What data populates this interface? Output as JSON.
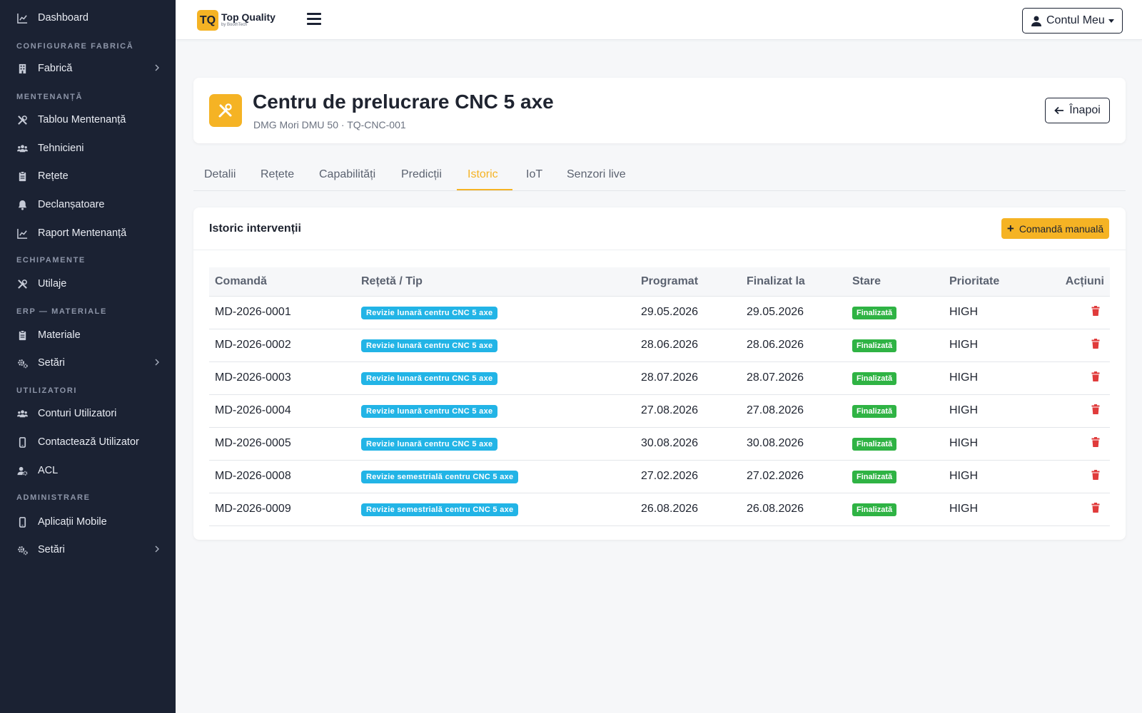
{
  "sidebar": {
    "items": [
      {
        "label": "Dashboard",
        "icon": "chart-line-icon"
      },
      {
        "label": "Fabrică",
        "icon": "building-icon",
        "has_submenu": true
      },
      {
        "label": "Tablou Mentenanță",
        "icon": "tools-icon"
      },
      {
        "label": "Tehnicieni",
        "icon": "users-icon"
      },
      {
        "label": "Rețete",
        "icon": "clipboard-icon"
      },
      {
        "label": "Declanșatoare",
        "icon": "bell-icon"
      },
      {
        "label": "Raport Mentenanță",
        "icon": "chart-line-icon"
      },
      {
        "label": "Utilaje",
        "icon": "tools-icon"
      },
      {
        "label": "Materiale",
        "icon": "clipboard-icon"
      },
      {
        "label": "Setări",
        "icon": "gears-icon",
        "has_submenu": true
      },
      {
        "label": "Conturi Utilizatori",
        "icon": "users-icon"
      },
      {
        "label": "Contactează Utilizator",
        "icon": "mobile-icon"
      },
      {
        "label": "ACL",
        "icon": "user-gear-icon"
      },
      {
        "label": "Aplicații Mobile",
        "icon": "mobile-icon"
      },
      {
        "label": "Setări",
        "icon": "gears-icon",
        "has_submenu": true
      }
    ],
    "sections": [
      "CONFIGURARE FABRICĂ",
      "MENTENANȚĂ",
      "ECHIPAMENTE",
      "ERP — MATERIALE",
      "UTILIZATORI",
      "ADMINISTRARE"
    ]
  },
  "topbar": {
    "logo_mark": "TQ",
    "logo_name": "Top Quality",
    "logo_sub": "by BoothTech",
    "account_label": "Contul Meu"
  },
  "header": {
    "title": "Centru de prelucrare CNC 5 axe",
    "subtitle": "DMG Mori DMU 50 · TQ-CNC-001",
    "back_label": "Înapoi"
  },
  "tabs": [
    {
      "label": "Detalii",
      "active": false
    },
    {
      "label": "Rețete",
      "active": false
    },
    {
      "label": "Capabilități",
      "active": false
    },
    {
      "label": "Predicții",
      "active": false
    },
    {
      "label": "Istoric",
      "active": true
    },
    {
      "label": "IoT",
      "active": false
    },
    {
      "label": "Senzori live",
      "active": false
    }
  ],
  "history": {
    "title": "Istoric intervenții",
    "manual_button": "Comandă manuală",
    "columns": [
      "Comandă",
      "Rețetă / Tip",
      "Programat",
      "Finalizat la",
      "Stare",
      "Prioritate",
      "Acțiuni"
    ],
    "rows": [
      {
        "order": "MD-2026-0001",
        "recipe": "Revizie lunară centru CNC 5 axe",
        "scheduled": "29.05.2026",
        "finished": "29.05.2026",
        "status": "Finalizată",
        "priority": "HIGH"
      },
      {
        "order": "MD-2026-0002",
        "recipe": "Revizie lunară centru CNC 5 axe",
        "scheduled": "28.06.2026",
        "finished": "28.06.2026",
        "status": "Finalizată",
        "priority": "HIGH"
      },
      {
        "order": "MD-2026-0003",
        "recipe": "Revizie lunară centru CNC 5 axe",
        "scheduled": "28.07.2026",
        "finished": "28.07.2026",
        "status": "Finalizată",
        "priority": "HIGH"
      },
      {
        "order": "MD-2026-0004",
        "recipe": "Revizie lunară centru CNC 5 axe",
        "scheduled": "27.08.2026",
        "finished": "27.08.2026",
        "status": "Finalizată",
        "priority": "HIGH"
      },
      {
        "order": "MD-2026-0005",
        "recipe": "Revizie lunară centru CNC 5 axe",
        "scheduled": "30.08.2026",
        "finished": "30.08.2026",
        "status": "Finalizată",
        "priority": "HIGH"
      },
      {
        "order": "MD-2026-0008",
        "recipe": "Revizie semestrială centru CNC 5 axe",
        "scheduled": "27.02.2026",
        "finished": "27.02.2026",
        "status": "Finalizată",
        "priority": "HIGH"
      },
      {
        "order": "MD-2026-0009",
        "recipe": "Revizie semestrială centru CNC 5 axe",
        "scheduled": "26.08.2026",
        "finished": "26.08.2026",
        "status": "Finalizată",
        "priority": "HIGH"
      }
    ]
  },
  "colors": {
    "sidebar_bg": "#1b2233",
    "accent": "#f5b324",
    "recipe_badge": "#22b4e6",
    "status_badge": "#2fb344",
    "delete": "#e03b3b"
  }
}
